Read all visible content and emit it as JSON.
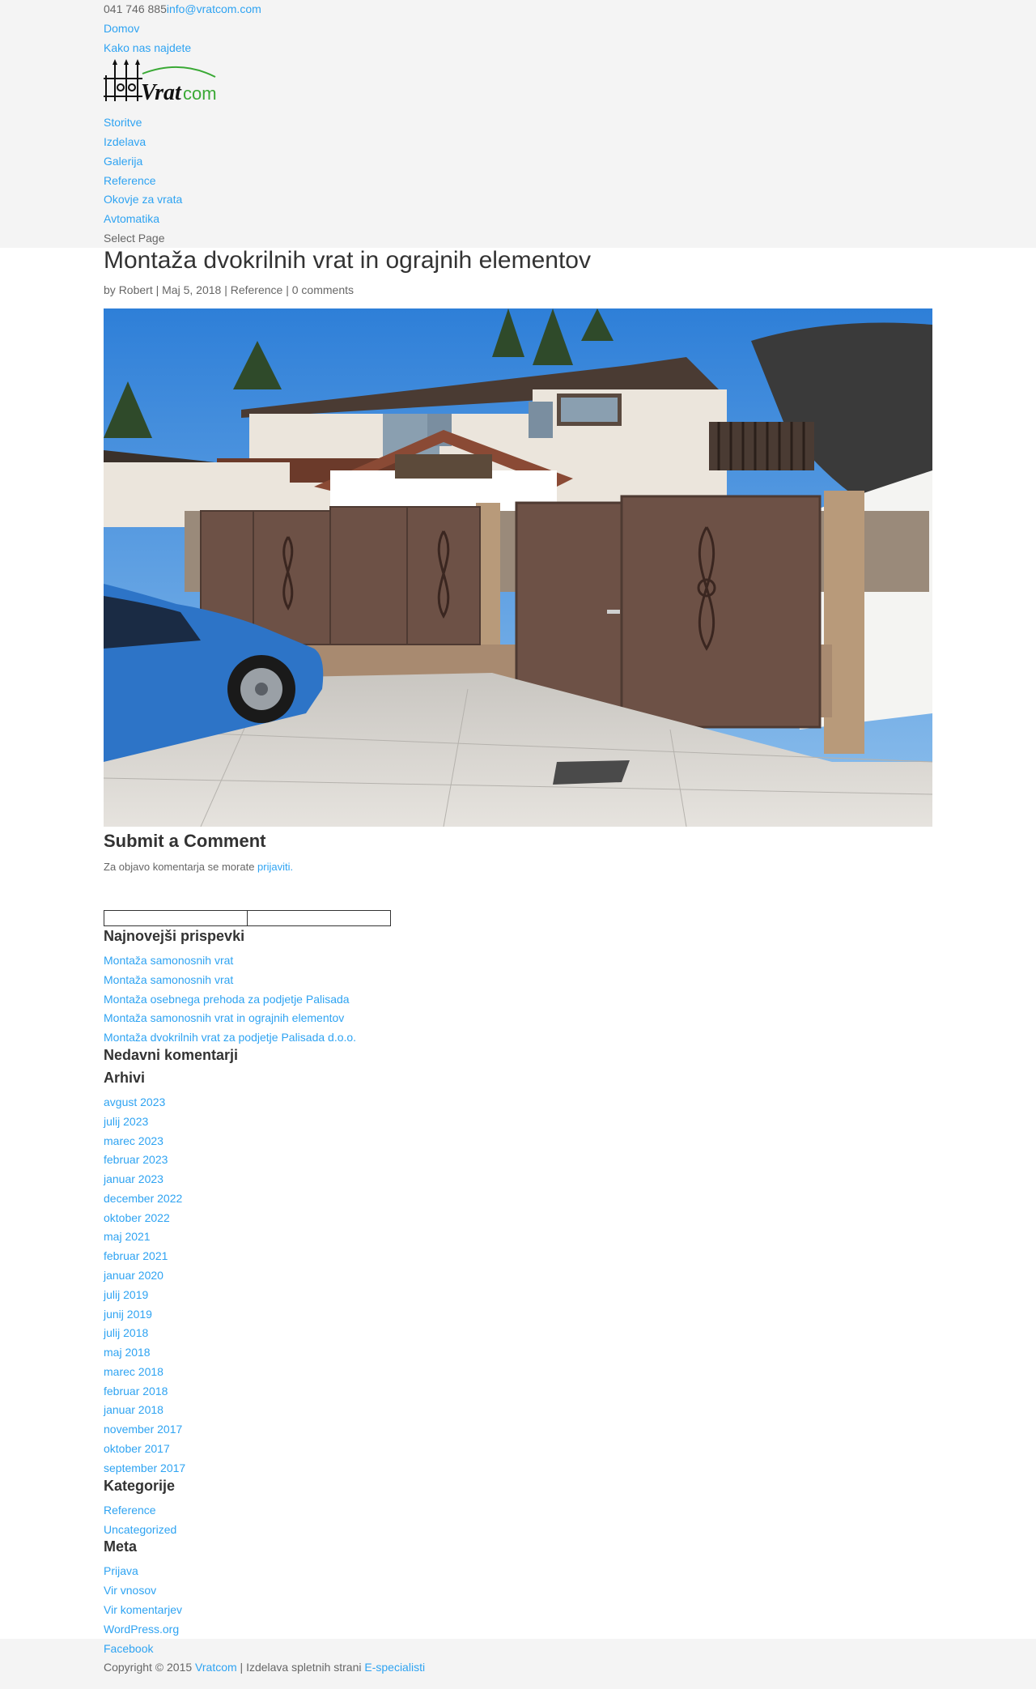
{
  "topbar": {
    "phone": "041 746 885",
    "email": "info@vratcom.com"
  },
  "secondary_nav": [
    "Domov",
    "Kako nas najdete"
  ],
  "logo": {
    "text_dark": "Vrat",
    "text_green": "com"
  },
  "main_nav": [
    "Storitve",
    "Izdelava",
    "Galerija",
    "Reference",
    "Okovje za vrata",
    "Avtomatika"
  ],
  "select_page": "Select Page",
  "post": {
    "title": "Montaža dvokrilnih vrat in ograjnih elementov",
    "meta_by": "by ",
    "author": "Robert",
    "sep1": " | ",
    "date": "Maj 5, 2018",
    "sep2": " | ",
    "category": "Reference",
    "sep3": " | ",
    "comments": "0 comments"
  },
  "comment": {
    "heading": "Submit a Comment",
    "login_text": "Za objavo komentarja se morate ",
    "login_link": "prijaviti."
  },
  "sidebar": {
    "recent_posts_title": "Najnovejši prispevki",
    "recent_posts": [
      "Montaža samonosnih vrat",
      "Montaža samonosnih vrat",
      "Montaža osebnega prehoda za podjetje Palisada",
      "Montaža samonosnih vrat in ograjnih elementov",
      "Montaža dvokrilnih vrat za podjetje Palisada d.o.o."
    ],
    "recent_comments_title": "Nedavni komentarji",
    "archives_title": "Arhivi",
    "archives": [
      "avgust 2023",
      "julij 2023",
      "marec 2023",
      "februar 2023",
      "januar 2023",
      "december 2022",
      "oktober 2022",
      "maj 2021",
      "februar 2021",
      "januar 2020",
      "julij 2019",
      "junij 2019",
      "julij 2018",
      "maj 2018",
      "marec 2018",
      "februar 2018",
      "januar 2018",
      "november 2017",
      "oktober 2017",
      "september 2017"
    ],
    "categories_title": "Kategorije",
    "categories": [
      "Reference",
      "Uncategorized"
    ],
    "meta_title": "Meta",
    "meta_links": [
      "Prijava",
      "Vir vnosov",
      "Vir komentarjev",
      "WordPress.org",
      "Facebook"
    ]
  },
  "footer": {
    "copyright": "Copyright © 2015 ",
    "brand": "Vratcom",
    "middle": " | Izdelava spletnih strani ",
    "agency": "E-specialisti"
  },
  "colors": {
    "link": "#2ea3f2",
    "band": "#f4f4f4",
    "logo_green": "#3aa935"
  }
}
